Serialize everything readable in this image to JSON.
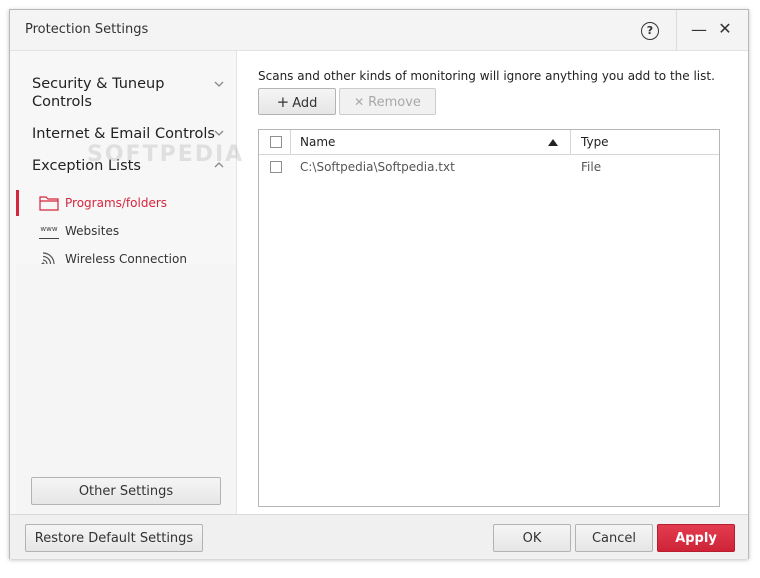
{
  "window": {
    "title": "Protection Settings",
    "help_glyph": "?",
    "minimize_glyph": "—",
    "close_glyph": "✕"
  },
  "sidebar": {
    "groups": [
      {
        "label": "Security & Tuneup Controls",
        "expanded": false
      },
      {
        "label": "Internet & Email Controls",
        "expanded": false
      },
      {
        "label": "Exception Lists",
        "expanded": true
      }
    ],
    "items": [
      {
        "label": "Programs/folders",
        "icon": "folder-icon",
        "active": true
      },
      {
        "label": "Websites",
        "icon": "www-icon",
        "active": false
      },
      {
        "label": "Wireless Connection",
        "icon": "wifi-icon",
        "active": false
      }
    ],
    "www_glyph": "www",
    "other_settings_label": "Other Settings"
  },
  "main": {
    "description": "Scans and other kinds of monitoring will ignore anything you add to the list.",
    "add_label": "Add",
    "add_glyph": "+",
    "remove_label": "Remove",
    "remove_glyph": "✕",
    "table": {
      "columns": [
        "Name",
        "Type"
      ],
      "sort_column": "Name",
      "sort_direction": "ascending",
      "rows": [
        {
          "name": "C:\\Softpedia\\Softpedia.txt",
          "type": "File"
        }
      ]
    }
  },
  "footer": {
    "restore_label": "Restore Default Settings",
    "ok_label": "OK",
    "cancel_label": "Cancel",
    "apply_label": "Apply"
  },
  "watermark": "SOFTPEDIA",
  "colors": {
    "accent": "#d6263d",
    "apply_button": "#d92d42",
    "window_bg": "#f7f7f7"
  }
}
